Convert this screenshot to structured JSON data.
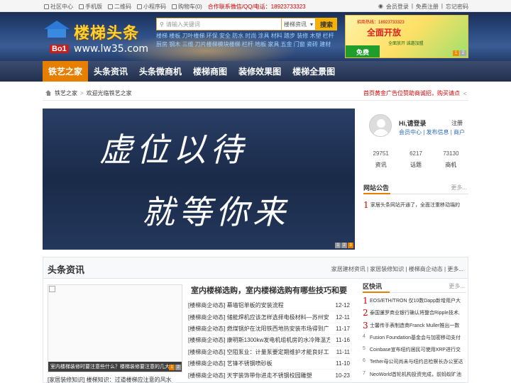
{
  "topbar": {
    "member_center": "社区中心",
    "mobile": "手机版",
    "qrcode": "二维码",
    "mini_program": "小程序码",
    "cart": "购物车(0)",
    "contact": "合作联系微信/QQ/电话：18923733323",
    "login": "会员登录",
    "register": "免费注册",
    "forgot": "忘记密码"
  },
  "header": {
    "logo_name": "楼梯头条",
    "logo_badge": "Bo1",
    "logo_url": "www.lw35.com",
    "search_placeholder": "请输入关键词",
    "search_type": "楼梯资讯",
    "search_button": "搜索",
    "hot_words": "楼梯 楼板 刀叶楼梯 环保 安全 防水 时尚 涂具 材料 踏步 装修 木塑 栏杆 厨房 钢木 三维 刀片楼梯模块楼梯 栏杆 地板 家具 五金 门窗 瓷砖 建材"
  },
  "ad": {
    "line1": "招商热线：18923733323",
    "line2": "全面开放",
    "line3": "全面放开 诚邀加盟",
    "free": "免费",
    "pages": [
      "1",
      "2"
    ]
  },
  "nav": {
    "items": [
      "铁艺之家",
      "头条资讯",
      "头条微商机",
      "楼梯商图",
      "装修效果图",
      "楼梯全景图"
    ]
  },
  "crumb": {
    "home": "铁艺之家",
    "welcome": "欢迎光临铁艺之家",
    "notice": "首页黄金广告位赞助商诚招，购买请点"
  },
  "slider": {
    "line1": "虚位以待",
    "line2": "就等你来",
    "pages": [
      "1",
      "2",
      "3"
    ]
  },
  "user": {
    "greeting": "Hi,请登录",
    "register": "注册",
    "links": "会员中心 | 发布信息 | 商户"
  },
  "stats": [
    {
      "num": "29751",
      "label": "资讯"
    },
    {
      "num": "6217",
      "label": "话题"
    },
    {
      "num": "73130",
      "label": "商机"
    }
  ],
  "announce": {
    "title": "网站公告",
    "more": "更多...",
    "items": [
      {
        "rank": "1",
        "text": "家居头条网站开通了，全面注重移动端的"
      }
    ]
  },
  "section": {
    "title": "头条资讯",
    "cats": "家居建材资讯 | 家居装修知识 | 楼梯商企动态 | 更多...",
    "pic_caption": "室内楼梯装修时要注意些什么？楼梯装修要注意的几大",
    "pic_pages": [
      "1",
      "2"
    ],
    "bottom_caption": "[家居装修知识] 楼梯知识：过道楼梯应注意的风水",
    "main_title": "室内楼梯选购，室内楼梯选购有哪些技巧和要",
    "rows": [
      {
        "text": "[楼梯商企动态] 幕墙铝单板的安装流程",
        "date": "12-12"
      },
      {
        "text": "[楼梯商企动态] 储能焊机应该怎样选择电极材料—苏州安",
        "date": "12-11"
      },
      {
        "text": "[楼梯商企动态] 燃煤锅炉在沈阳铁西地热安装市场得到广",
        "date": "11-17"
      },
      {
        "text": "[楼梯商企动态] 康明斯1300kw发电机组机房的水冷降温方",
        "date": "11-16"
      },
      {
        "text": "[楼梯商企动态] 空阻泵业：计量泵要定期维护才能良好工",
        "date": "11-11"
      },
      {
        "text": "[楼梯商企动态] 艺锋不锈钢喷砂板",
        "date": "11-10"
      },
      {
        "text": "[楼梯商企动态] 天宇装饰带你进走不锈钢校园雕塑",
        "date": "10-23"
      }
    ],
    "flash_title": "区快讯",
    "flash_more": "更多...",
    "flash": [
      {
        "no": "1",
        "text": "EOS/ETH/TRON 仅10数Dapp新增用户大"
      },
      {
        "no": "2",
        "text": "泰国暹罗商业银行确认将整合Ripple技术,"
      },
      {
        "no": "3",
        "text": "士馨传手表制造商Franck Muller推出一数"
      },
      {
        "no": "4",
        "text": "Fusion Foundation基金会与加密移动支付"
      },
      {
        "no": "5",
        "text": "Coinbase宣布纽约居民可使用XRP进行交"
      },
      {
        "no": "6",
        "text": "Tether母公司尚未与纽约总检察长办公室达"
      },
      {
        "no": "7",
        "text": "NeoWorld首轮机构投资完成，前蚂蚁旷池"
      }
    ]
  },
  "colors": {
    "accent": "#e67e00",
    "notice_red": "#d10000",
    "nav_bg": "#2d3c5c"
  }
}
